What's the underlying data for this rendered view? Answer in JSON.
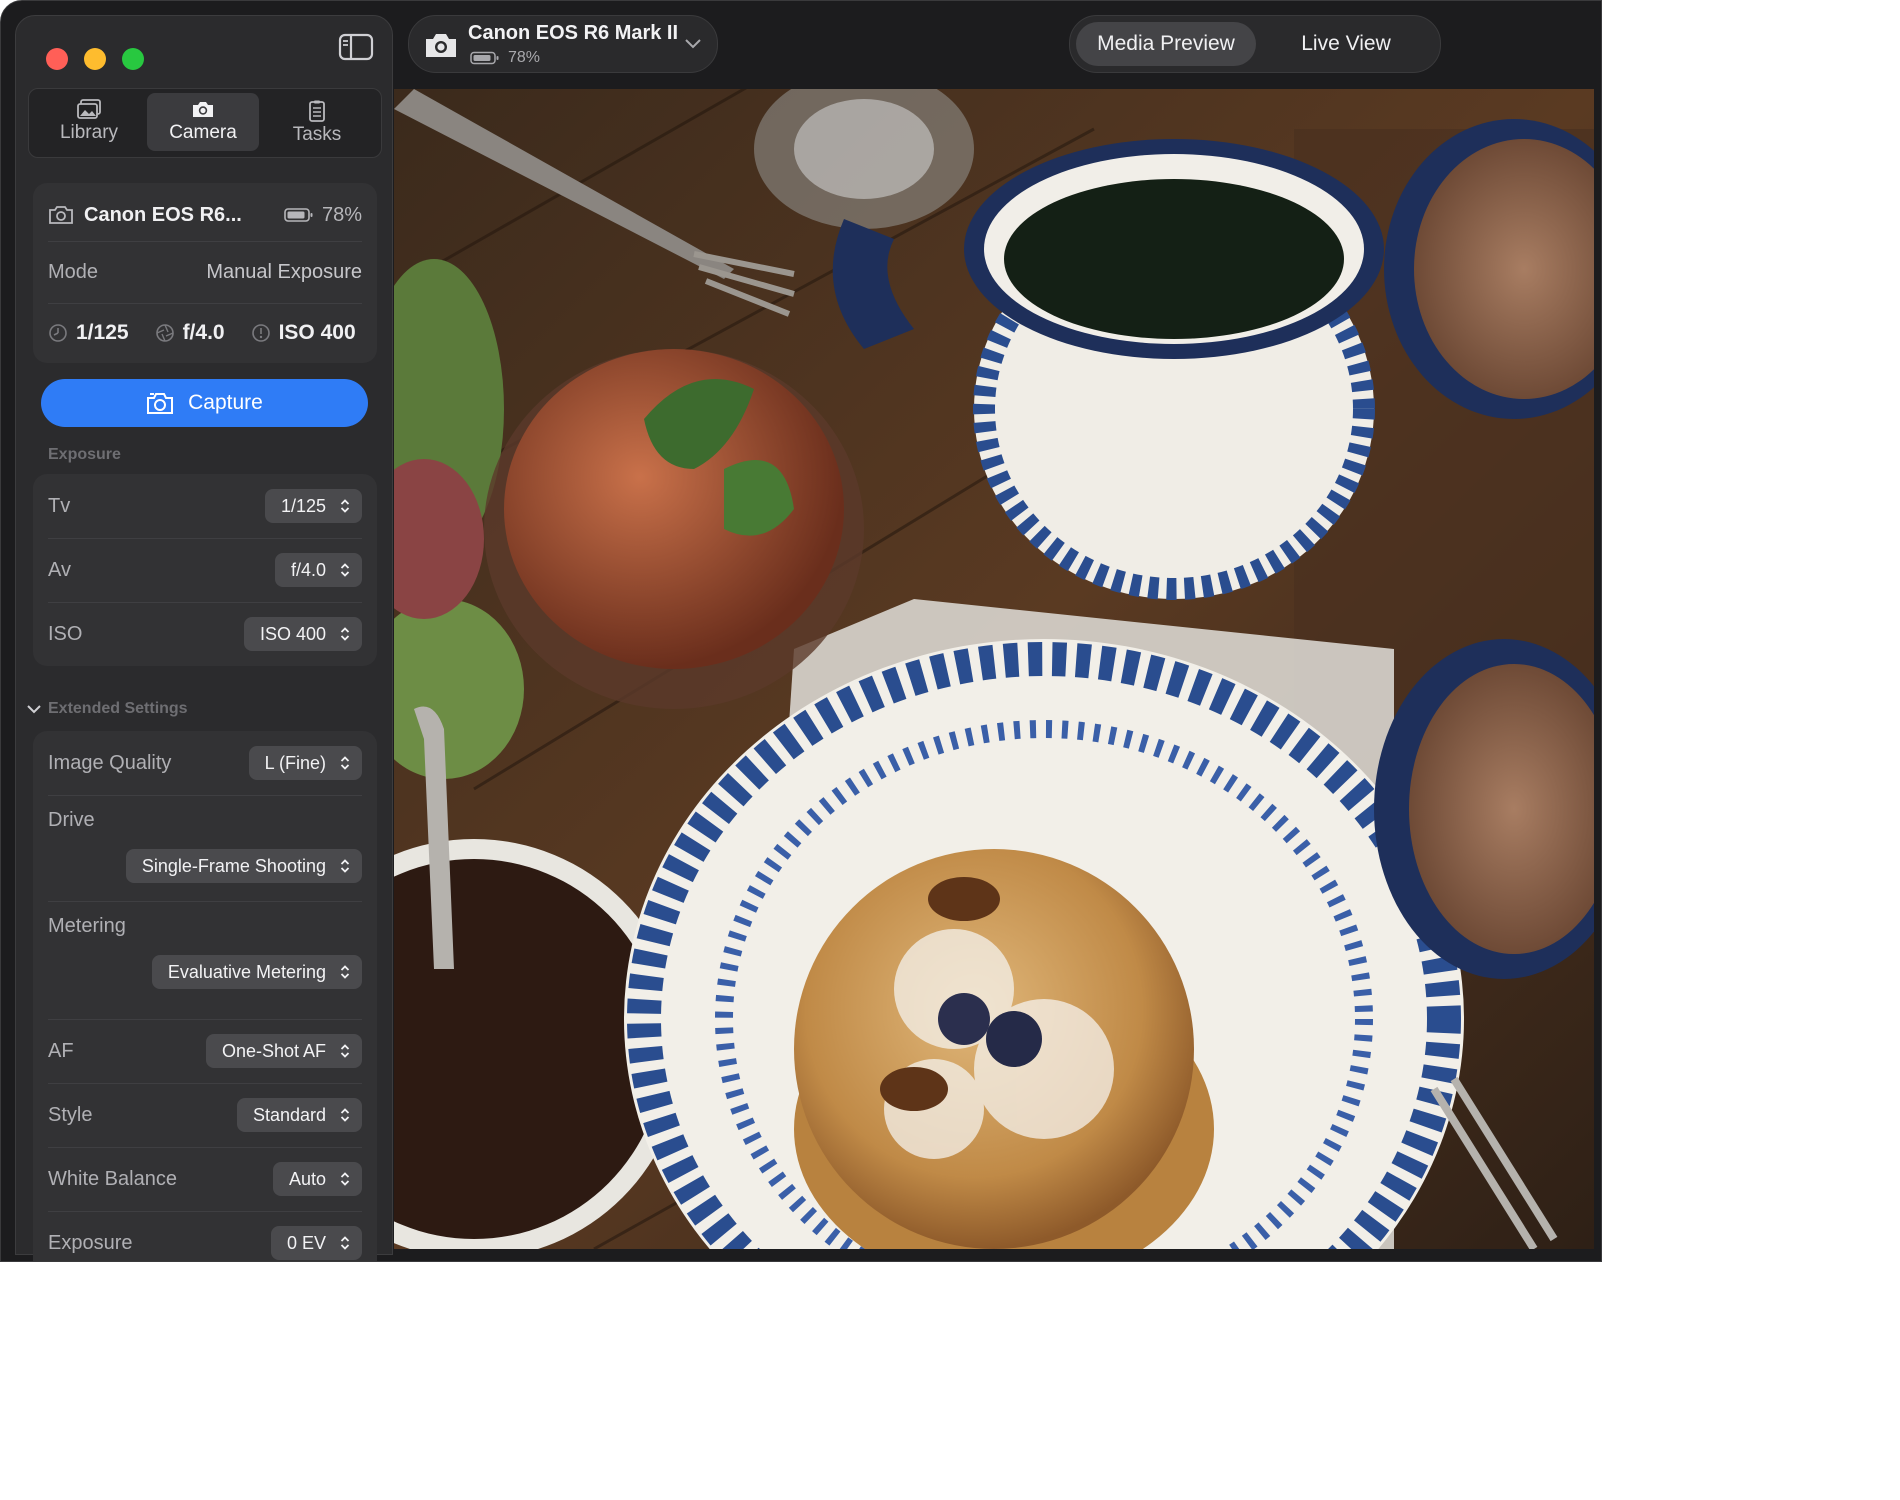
{
  "sidebar": {
    "tabs": [
      {
        "label": "Library",
        "icon": "photo-library-icon"
      },
      {
        "label": "Camera",
        "icon": "camera-icon",
        "active": true
      },
      {
        "label": "Tasks",
        "icon": "clipboard-icon"
      }
    ],
    "camera_card": {
      "name": "Canon EOS R6...",
      "battery": "78%",
      "mode_label": "Mode",
      "mode_value": "Manual Exposure",
      "shutter": "1/125",
      "aperture": "f/4.0",
      "iso": "ISO 400"
    },
    "capture_label": "Capture",
    "exposure_section": "Exposure",
    "exposure": [
      {
        "label": "Tv",
        "value": "1/125"
      },
      {
        "label": "Av",
        "value": "f/4.0"
      },
      {
        "label": "ISO",
        "value": "ISO 400"
      }
    ],
    "extended_section": "Extended Settings",
    "extended": {
      "image_quality": {
        "label": "Image Quality",
        "value": "L (Fine)"
      },
      "drive": {
        "label": "Drive",
        "value": "Single-Frame Shooting"
      },
      "metering": {
        "label": "Metering",
        "value": "Evaluative Metering"
      },
      "af": {
        "label": "AF",
        "value": "One-Shot AF"
      },
      "style": {
        "label": "Style",
        "value": "Standard"
      },
      "white_balance": {
        "label": "White Balance",
        "value": "Auto"
      },
      "exposure_comp": {
        "label": "Exposure",
        "value": "0 EV"
      }
    }
  },
  "toolbar": {
    "device_name": "Canon EOS R6 Mark II",
    "device_battery": "78%",
    "view_modes": [
      "Media Preview",
      "Live View"
    ],
    "active_view": "Media Preview"
  },
  "colors": {
    "accent": "#2f7cf6",
    "window_bg": "#1c1c1e",
    "sidebar_bg": "#2b2b2d",
    "card_bg": "#323234"
  }
}
